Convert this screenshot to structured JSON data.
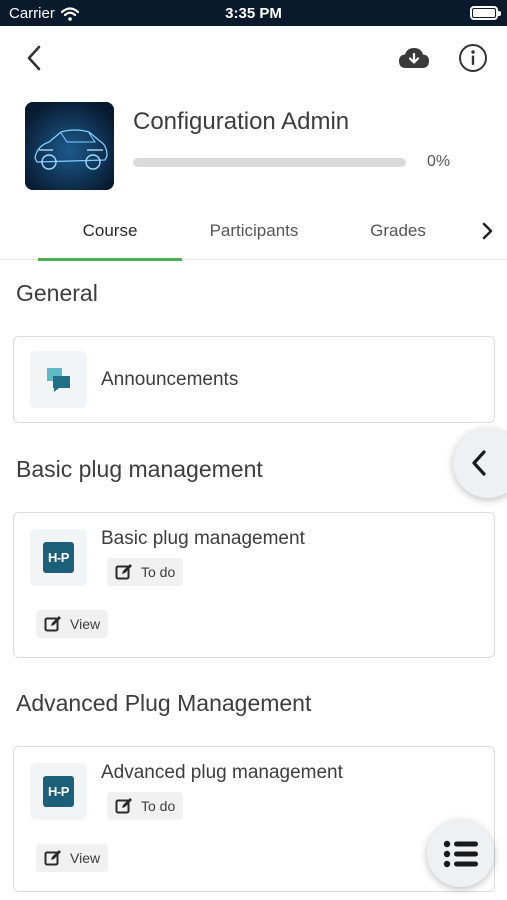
{
  "status_bar": {
    "carrier": "Carrier",
    "time": "3:35 PM"
  },
  "course": {
    "title": "Configuration Admin",
    "progress_label": "0%",
    "progress_value": 0
  },
  "tabs": [
    {
      "label": "Course",
      "active": true
    },
    {
      "label": "Participants",
      "active": false
    },
    {
      "label": "Grades",
      "active": false
    }
  ],
  "sections": [
    {
      "title": "General",
      "modules": [
        {
          "name": "Announcements",
          "icon": "forum-icon"
        }
      ]
    },
    {
      "title": "Basic plug management",
      "modules": [
        {
          "name": "Basic plug management",
          "icon": "h5p-icon",
          "icon_text": "H-P",
          "status": "To do",
          "action": "View"
        }
      ]
    },
    {
      "title": "Advanced Plug Management",
      "modules": [
        {
          "name": "Advanced plug management",
          "icon": "h5p-icon",
          "icon_text": "H-P",
          "status": "To do",
          "action": "View"
        }
      ]
    }
  ],
  "colors": {
    "status_bar": "#0a1a2c",
    "accent": "#4caf50",
    "h5p": "#1c5f7a",
    "forum_icon": "#2c8c9a"
  }
}
